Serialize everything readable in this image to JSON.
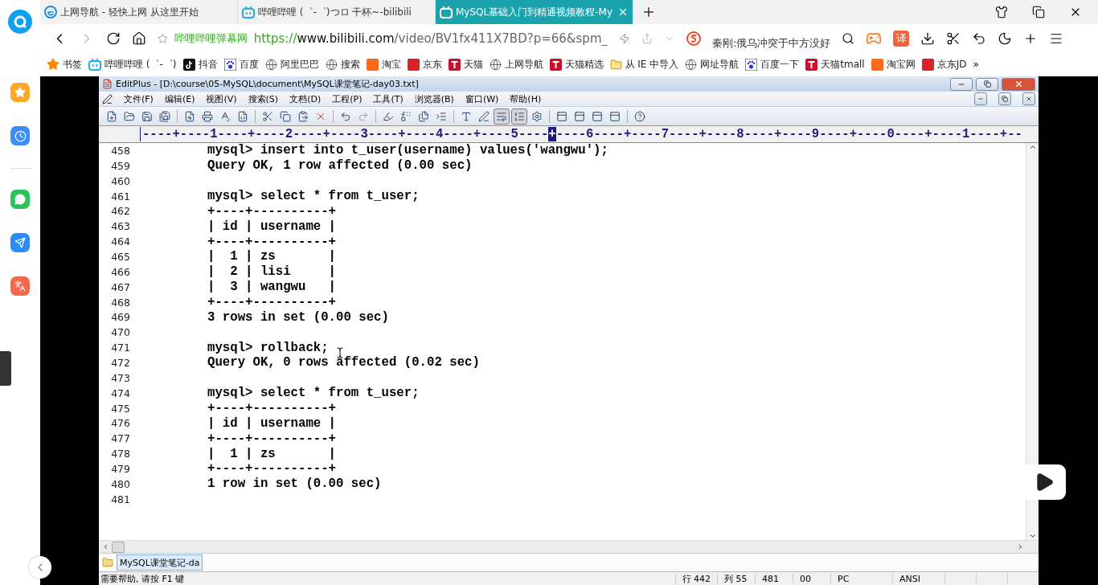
{
  "browser": {
    "tabs": [
      {
        "kind": "ie",
        "title": "上网导航 - 轻快上网 从这里开始",
        "selected": false
      },
      {
        "kind": "tv",
        "title": "哔哩哔哩 (゜-゜)つロ 干杯~-bilibili",
        "selected": false
      },
      {
        "kind": "tv",
        "title": "MySQL基础入门到精通视频教程-My",
        "selected": true
      }
    ],
    "address": {
      "site_name": "哔哩哔哩弹幕网",
      "scheme": "https://",
      "host": "www.bilibili.com",
      "path": "/video/BV1fx411X7BD?p=66&spm_"
    },
    "hot_search": "秦刚:俄乌冲突于中方没好",
    "translate_badge": "译",
    "bookmarks": [
      {
        "kind": "star",
        "label": "书签"
      },
      {
        "kind": "tv",
        "label": "哔哩哔哩 (゜-゜)"
      },
      {
        "kind": "tiktok",
        "label": "抖音"
      },
      {
        "kind": "paw",
        "label": "百度"
      },
      {
        "kind": "globe",
        "label": "阿里巴巴"
      },
      {
        "kind": "globe",
        "label": "搜索"
      },
      {
        "kind": "taobao",
        "label": "淘宝"
      },
      {
        "kind": "jd",
        "label": "京东"
      },
      {
        "kind": "tmall",
        "label": "天猫"
      },
      {
        "kind": "globe",
        "label": "上网导航"
      },
      {
        "kind": "tmall",
        "label": "天猫精选"
      },
      {
        "kind": "folder",
        "label": "从 IE 中导入"
      },
      {
        "kind": "globe",
        "label": "网址导航"
      },
      {
        "kind": "paw",
        "label": "百度一下"
      },
      {
        "kind": "tmall",
        "label": "天猫tmall"
      },
      {
        "kind": "taobao",
        "label": "淘宝网"
      },
      {
        "kind": "jd",
        "label": "京东JD"
      }
    ],
    "bookmarks_more": "»"
  },
  "editor": {
    "title": "EditPlus - [D:\\course\\05-MySQL\\document\\MySQL课堂笔记-day03.txt]",
    "menus": [
      "文件(F)",
      "编辑(E)",
      "视图(V)",
      "搜索(S)",
      "文档(D)",
      "工程(P)",
      "工具(T)",
      "浏览器(B)",
      "窗口(W)",
      "帮助(H)"
    ],
    "toolbar": [
      {
        "kind": "new",
        "pressed": false,
        "disabled": false
      },
      {
        "kind": "open",
        "pressed": false,
        "disabled": false
      },
      {
        "kind": "save",
        "pressed": false,
        "disabled": false
      },
      {
        "kind": "save-all",
        "pressed": false,
        "disabled": false
      },
      {
        "kind": "separator"
      },
      {
        "kind": "preview",
        "pressed": false,
        "disabled": false
      },
      {
        "kind": "print",
        "pressed": false,
        "disabled": false
      },
      {
        "kind": "spell",
        "pressed": false,
        "disabled": false
      },
      {
        "kind": "html",
        "pressed": false,
        "disabled": false
      },
      {
        "kind": "separator"
      },
      {
        "kind": "cut",
        "pressed": false,
        "disabled": false
      },
      {
        "kind": "copy",
        "pressed": false,
        "disabled": false
      },
      {
        "kind": "paste",
        "pressed": false,
        "disabled": false
      },
      {
        "kind": "delete",
        "pressed": false,
        "disabled": false
      },
      {
        "kind": "separator"
      },
      {
        "kind": "undo",
        "pressed": false,
        "disabled": false
      },
      {
        "kind": "redo",
        "pressed": false,
        "disabled": true
      },
      {
        "kind": "separator"
      },
      {
        "kind": "find",
        "pressed": false,
        "disabled": false
      },
      {
        "kind": "replace",
        "pressed": false,
        "disabled": false
      },
      {
        "kind": "duplicate",
        "pressed": false,
        "disabled": false
      },
      {
        "kind": "indent",
        "pressed": false,
        "disabled": false
      },
      {
        "kind": "separator"
      },
      {
        "kind": "font",
        "pressed": false,
        "disabled": false
      },
      {
        "kind": "pen",
        "pressed": false,
        "disabled": false
      },
      {
        "kind": "wrap",
        "pressed": true,
        "disabled": false
      },
      {
        "kind": "line-numbers",
        "pressed": true,
        "disabled": false
      },
      {
        "kind": "config",
        "pressed": false,
        "disabled": false
      },
      {
        "kind": "separator"
      },
      {
        "kind": "panel",
        "pressed": false,
        "disabled": false
      },
      {
        "kind": "panel",
        "pressed": false,
        "disabled": false
      },
      {
        "kind": "panel",
        "pressed": false,
        "disabled": false
      },
      {
        "kind": "panel",
        "pressed": false,
        "disabled": false
      },
      {
        "kind": "separator"
      },
      {
        "kind": "help",
        "pressed": false,
        "disabled": false
      }
    ],
    "ruler": {
      "before": "----+----1----+----2----+----3----+----4----+----5----",
      "cursor": "+",
      "after": "----6----+----7----+----8----+----9----+----0----+----1----+--"
    },
    "lines": [
      {
        "number": "458",
        "text": "mysql> insert into t_user(username) values('wangwu');"
      },
      {
        "number": "459",
        "text": "Query OK, 1 row affected (0.00 sec)"
      },
      {
        "number": "460"
      },
      {
        "number": "461",
        "text": "mysql> select * from t_user;"
      },
      {
        "number": "462",
        "text": "+----+----------+"
      },
      {
        "number": "463",
        "text": "| id | username |"
      },
      {
        "number": "464",
        "text": "+----+----------+"
      },
      {
        "number": "465",
        "text": "|  1 | zs       |"
      },
      {
        "number": "466",
        "text": "|  2 | lisi     |"
      },
      {
        "number": "467",
        "text": "|  3 | wangwu   |"
      },
      {
        "number": "468",
        "text": "+----+----------+"
      },
      {
        "number": "469",
        "text": "3 rows in set (0.00 sec)"
      },
      {
        "number": "470"
      },
      {
        "number": "471",
        "text": "mysql> rollback;"
      },
      {
        "number": "472",
        "text": "Query OK, 0 rows affected (0.02 sec)"
      },
      {
        "number": "473"
      },
      {
        "number": "474",
        "text": "mysql> select * from t_user;"
      },
      {
        "number": "475",
        "text": "+----+----------+"
      },
      {
        "number": "476",
        "text": "| id | username |"
      },
      {
        "number": "477",
        "text": "+----+----------+"
      },
      {
        "number": "478",
        "text": "|  1 | zs       |"
      },
      {
        "number": "479",
        "text": "+----+----------+"
      },
      {
        "number": "480",
        "text": "1 row in set (0.00 sec)"
      },
      {
        "number": "481"
      }
    ],
    "file_tabs": [
      {
        "label": "MySQL课堂笔记-da",
        "selected": true
      }
    ],
    "status": [
      "需要帮助, 请按 F1 键",
      "行 442",
      "列 55",
      "481",
      "00",
      "PC",
      "ANSI"
    ]
  }
}
